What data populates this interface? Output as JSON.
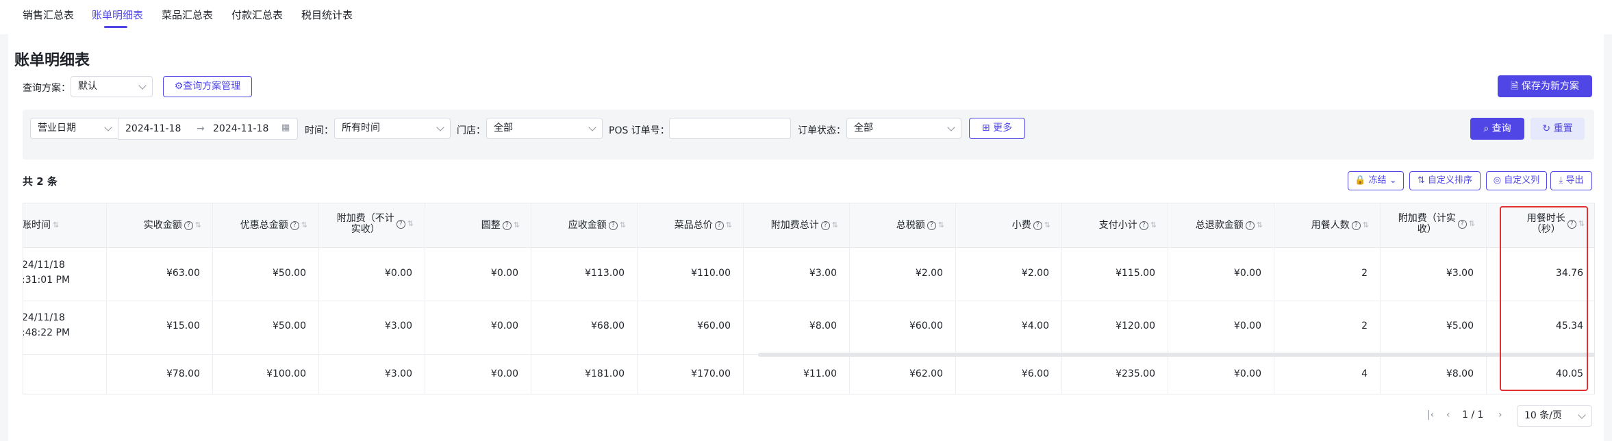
{
  "tabs": [
    "销售汇总表",
    "账单明细表",
    "菜品汇总表",
    "付款汇总表",
    "税目统计表"
  ],
  "page_title": "账单明细表",
  "query_plan": {
    "label": "查询方案：",
    "value": "默认",
    "manage_button": "查询方案管理"
  },
  "save_plan_button": "保存为新方案",
  "filters": {
    "date_type": "营业日期",
    "start_date": "2024-11-18",
    "end_date": "2024-11-18",
    "date_sep": "→",
    "time_label": "时间：",
    "time_value": "所有时间",
    "store_label": "门店：",
    "store_value": "全部",
    "pos_label": "POS 订单号：",
    "pos_value": "",
    "status_label": "订单状态：",
    "status_value": "全部",
    "more_button": "更多",
    "query_button": "查询",
    "reset_button": "重置"
  },
  "total_count": "共 2 条",
  "toolbar": {
    "freeze": "冻结",
    "custom_sort": "自定义排序",
    "custom_cols": "自定义列",
    "export": "导出"
  },
  "columns": [
    {
      "l1": "账时间",
      "l2": "",
      "q": false
    },
    {
      "l1": "实收金额",
      "l2": "",
      "q": true
    },
    {
      "l1": "优惠总金额",
      "l2": "",
      "q": true
    },
    {
      "l1": "附加费（不计",
      "l2": "实收）",
      "q": true
    },
    {
      "l1": "圆整",
      "l2": "",
      "q": true
    },
    {
      "l1": "应收金额",
      "l2": "",
      "q": true
    },
    {
      "l1": "菜品总价",
      "l2": "",
      "q": true
    },
    {
      "l1": "附加费总计",
      "l2": "",
      "q": true
    },
    {
      "l1": "总税额",
      "l2": "",
      "q": true
    },
    {
      "l1": "小费",
      "l2": "",
      "q": true
    },
    {
      "l1": "支付小计",
      "l2": "",
      "q": true
    },
    {
      "l1": "总退款金额",
      "l2": "",
      "q": true
    },
    {
      "l1": "用餐人数",
      "l2": "",
      "q": true
    },
    {
      "l1": "附加费（计实",
      "l2": "收）",
      "q": true
    },
    {
      "l1": "用餐时长",
      "l2": "（秒）",
      "q": true
    }
  ],
  "rows": [
    {
      "time1": "24/11/18",
      "time2": ":31:01 PM",
      "cells": [
        "¥63.00",
        "¥50.00",
        "¥0.00",
        "¥0.00",
        "¥113.00",
        "¥110.00",
        "¥3.00",
        "¥2.00",
        "¥2.00",
        "¥115.00",
        "¥0.00",
        "2",
        "¥3.00",
        "34.76"
      ]
    },
    {
      "time1": "24/11/18",
      "time2": ":48:22 PM",
      "cells": [
        "¥15.00",
        "¥50.00",
        "¥3.00",
        "¥0.00",
        "¥68.00",
        "¥60.00",
        "¥8.00",
        "¥60.00",
        "¥4.00",
        "¥120.00",
        "¥0.00",
        "2",
        "¥5.00",
        "45.34"
      ]
    }
  ],
  "summary": [
    "¥78.00",
    "¥100.00",
    "¥3.00",
    "¥0.00",
    "¥181.00",
    "¥170.00",
    "¥11.00",
    "¥62.00",
    "¥6.00",
    "¥235.00",
    "¥0.00",
    "4",
    "¥8.00",
    "40.05"
  ],
  "pager": {
    "page": "1 / 1",
    "page_size": "10 条/页"
  },
  "colors": {
    "accent": "#4f46e5",
    "highlight": "#e53030"
  }
}
